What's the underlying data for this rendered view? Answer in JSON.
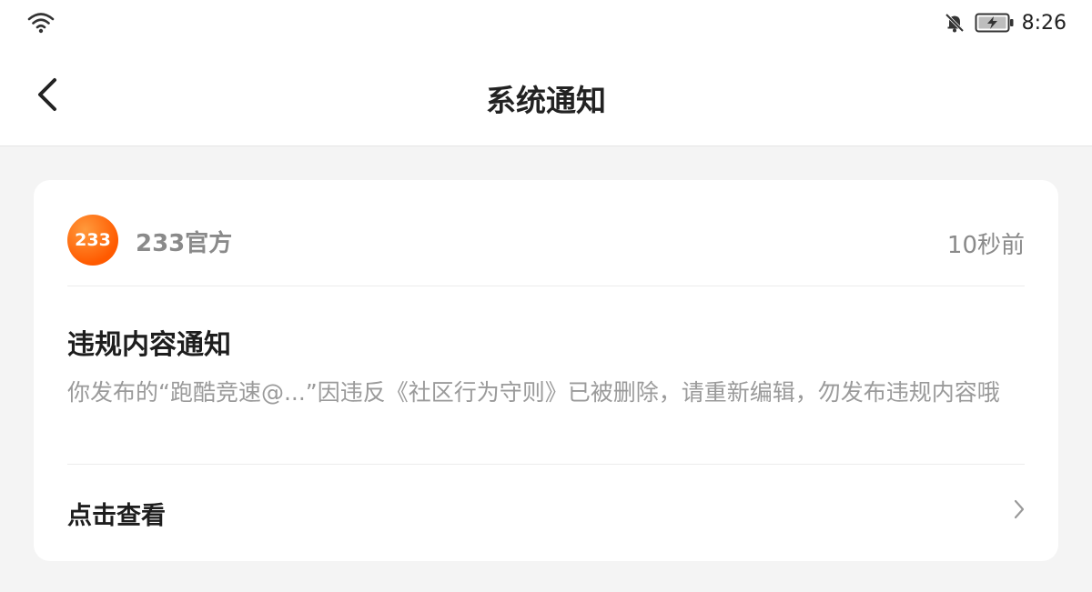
{
  "status_bar": {
    "time": "8:26",
    "icons": [
      "wifi-icon",
      "bell-off-icon",
      "battery-charging-icon"
    ]
  },
  "header": {
    "title": "系统通知",
    "back_icon": "back-arrow-icon"
  },
  "notification": {
    "avatar_text": "233",
    "sender": "233官方",
    "time": "10秒前",
    "title": "违规内容通知",
    "body": "你发布的“跑酷竞速@...”因违反《社区行为守则》已被删除，请重新编辑，勿发布违规内容哦",
    "action_label": "点击查看",
    "action_icon": "chevron-right-icon"
  },
  "colors": {
    "accent": "#ff6a00",
    "background": "#f4f4f4",
    "card": "#ffffff"
  }
}
